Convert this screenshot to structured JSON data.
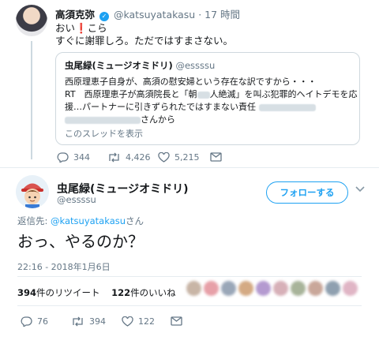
{
  "quoted_by": {
    "name": "高須克弥",
    "handle": "@katsuyatakasu",
    "time": "17 時間",
    "line1_a": "おい",
    "line1_excl": "❗",
    "line1_b": "こら",
    "line2": "すぐに謝罪しろ。ただではすまさない。",
    "actions": {
      "replies": "344",
      "retweets": "4,426",
      "likes": "5,215"
    }
  },
  "quote_card": {
    "name": "虫尾緑(ミュージオミドリ)",
    "handle": "@essssu",
    "line1": "西原理恵子自身が、高須の慰安婦という存在な訳ですから・・・",
    "line2": "RT　西原理恵子が高須院長と「朝",
    "line2_b": "人絶滅」を叫ぶ犯罪的ヘイトデモを応",
    "line3": "援…パートナーに引きずられたではすまない責任",
    "line4_suffix": "さんから",
    "thread_link": "このスレッドを表示"
  },
  "main_tweet": {
    "name": "虫尾緑(ミュージオミドリ)",
    "handle": "@essssu",
    "follow_label": "フォローする",
    "reply_prefix": "返信先: ",
    "reply_handle": "@katsuyatakasu",
    "reply_suffix": "さん",
    "text": "おっ、やるのか？",
    "timestamp": "22:16 - 2018年1月6日",
    "retweet_count": "394",
    "retweet_label": "件のリツイート",
    "like_count": "122",
    "like_label": "件のいいね",
    "actions": {
      "replies": "76",
      "retweets": "394",
      "likes": "122"
    }
  },
  "colors": {
    "accent": "#1da1f2",
    "muted": "#657786",
    "border": "#e6ecf0"
  }
}
